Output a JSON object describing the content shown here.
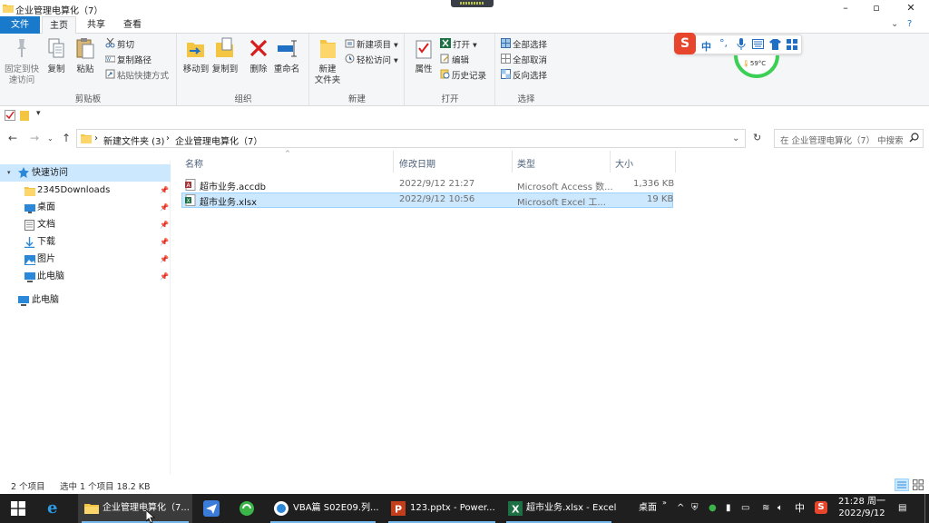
{
  "window": {
    "title": "企业管理电算化（7）",
    "minimize_glyph": "–",
    "maximize_glyph": "▫",
    "close_glyph": "✕"
  },
  "tabs": [
    {
      "label": "文件"
    },
    {
      "label": "主页"
    },
    {
      "label": "共享"
    },
    {
      "label": "查看"
    }
  ],
  "ribbon": {
    "clipboard": {
      "label": "剪贴板",
      "pin": "固定到快\n速访问",
      "copy": "复制",
      "paste": "粘贴",
      "cut": "剪切",
      "copy_path": "复制路径",
      "paste_shortcut": "粘贴快捷方式"
    },
    "organize": {
      "label": "组织",
      "move_to": "移动到",
      "copy_to": "复制到",
      "delete": "删除",
      "rename": "重命名"
    },
    "new": {
      "label": "新建",
      "new_folder": "新建\n文件夹",
      "new_item": "新建项目",
      "easy_access": "轻松访问"
    },
    "open": {
      "label": "打开",
      "properties": "属性",
      "open": "打开",
      "edit": "编辑",
      "history": "历史记录"
    },
    "select": {
      "label": "选择",
      "select_all": "全部选择",
      "select_none": "全部取消",
      "invert": "反向选择"
    }
  },
  "ime": {
    "mode": "中",
    "temp": "59°C"
  },
  "address": {
    "crumbs": [
      "新建文件夹 (3)",
      "企业管理电算化（7）"
    ],
    "search_placeholder": "在 企业管理电算化（7） 中搜索"
  },
  "nav": {
    "quick_access": "快速访问",
    "items": [
      {
        "label": "2345Downloads"
      },
      {
        "label": "桌面"
      },
      {
        "label": "文档"
      },
      {
        "label": "下载"
      },
      {
        "label": "图片"
      },
      {
        "label": "此电脑"
      }
    ],
    "this_pc": "此电脑"
  },
  "columns": {
    "name": "名称",
    "modified": "修改日期",
    "type": "类型",
    "size": "大小"
  },
  "files": [
    {
      "name": "超市业务.accdb",
      "modified": "2022/9/12 21:27",
      "type": "Microsoft Access 数...",
      "size": "1,336 KB"
    },
    {
      "name": "超市业务.xlsx",
      "modified": "2022/9/12 10:56",
      "type": "Microsoft Excel 工...",
      "size": "19 KB"
    }
  ],
  "status": {
    "count": "2 个项目",
    "selection": "选中 1 个项目  18.2 KB"
  },
  "taskbar": {
    "explorer": "企业管理电算化（7...",
    "vba": "VBA篇 S02E09.列...",
    "ppt": "123.pptx - Power...",
    "excel": "超市业务.xlsx - Excel",
    "desktop": "桌面",
    "ime": "中",
    "time": "21:28 周一",
    "date": "2022/9/12"
  },
  "colors": {
    "accent": "#1979ca",
    "selection": "#cce8ff",
    "taskbar": "#1f1f1f"
  }
}
